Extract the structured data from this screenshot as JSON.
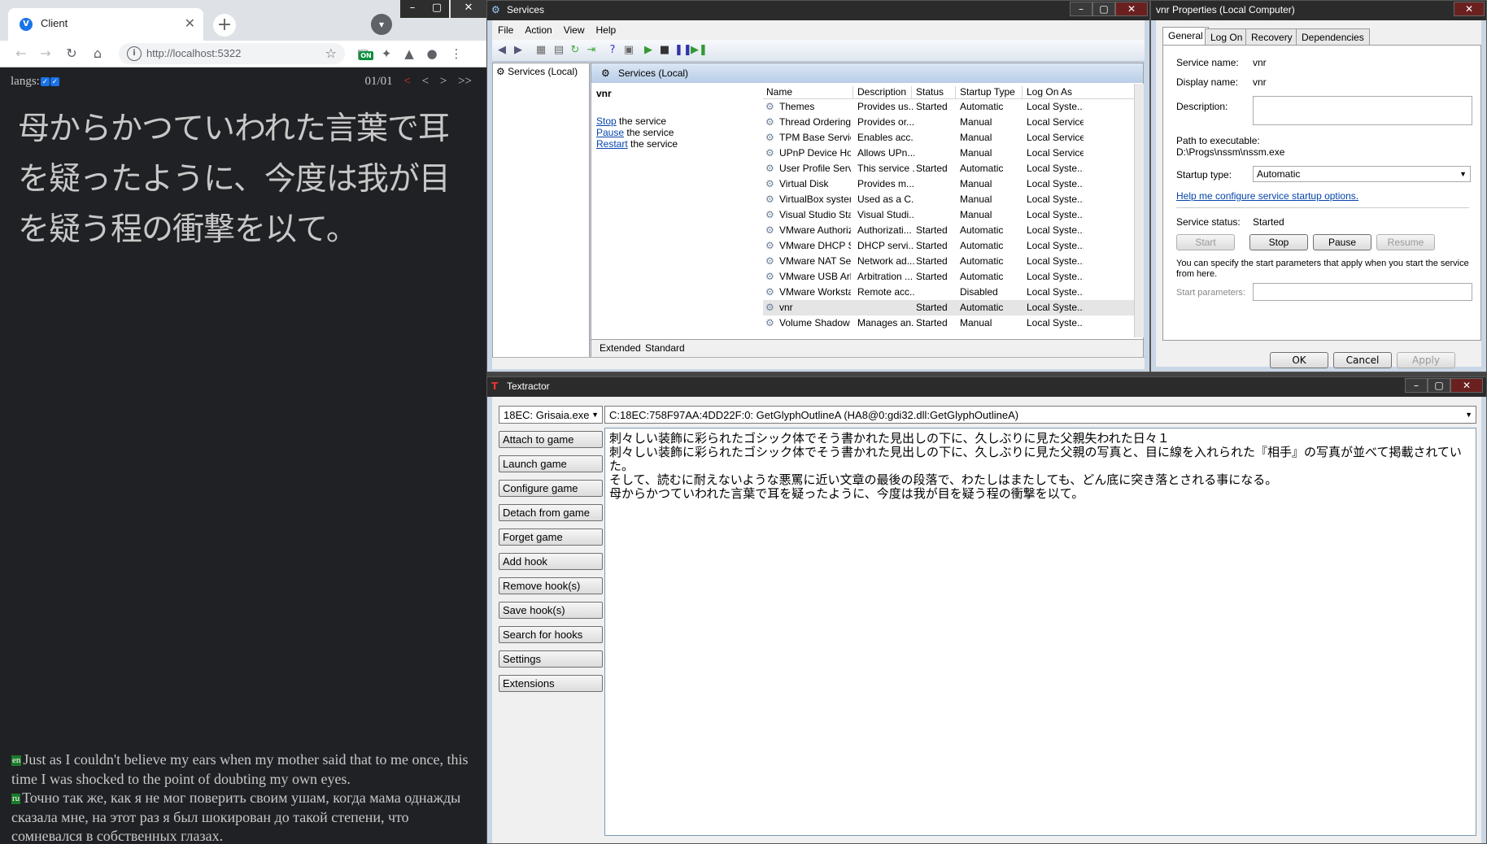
{
  "chrome": {
    "tab_title": "Client",
    "favicon_letter": "V",
    "url": "http://localhost:5322",
    "on_badge": "ON",
    "page": {
      "langs_label": "langs:",
      "pager": {
        "count": "01/01",
        "first": "<",
        "prev": "<",
        "next": ">",
        "last": ">>"
      },
      "japanese_text": "母からかつていわれた言葉で耳を疑ったように、今度は我が目を疑う程の衝撃を以て。",
      "translations": [
        {
          "lang": "en",
          "text": "Just as I couldn't believe my ears when my mother said that to me once, this time I was shocked to the point of doubting my own eyes."
        },
        {
          "lang": "ru",
          "text": "Точно так же, как я не мог поверить своим ушам, когда мама однажды сказала мне, на этот раз я был шокирован до такой степени, что сомневался в собственных глазах."
        }
      ]
    }
  },
  "services": {
    "title": "Services",
    "menu": [
      "File",
      "Action",
      "View",
      "Help"
    ],
    "tree_node": "Services (Local)",
    "header": "Services (Local)",
    "selected_name": "vnr",
    "actions": [
      {
        "link": "Stop",
        "rest": " the service"
      },
      {
        "link": "Pause",
        "rest": " the service"
      },
      {
        "link": "Restart",
        "rest": " the service"
      }
    ],
    "columns": [
      "Name",
      "Description",
      "Status",
      "Startup Type",
      "Log On As"
    ],
    "rows": [
      [
        "Themes",
        "Provides us...",
        "Started",
        "Automatic",
        "Local Syste..."
      ],
      [
        "Thread Ordering S...",
        "Provides or...",
        "",
        "Manual",
        "Local Service"
      ],
      [
        "TPM Base Services",
        "Enables acc...",
        "",
        "Manual",
        "Local Service"
      ],
      [
        "UPnP Device Host",
        "Allows UPn...",
        "",
        "Manual",
        "Local Service"
      ],
      [
        "User Profile Service",
        "This service ...",
        "Started",
        "Automatic",
        "Local Syste..."
      ],
      [
        "Virtual Disk",
        "Provides m...",
        "",
        "Manual",
        "Local Syste..."
      ],
      [
        "VirtualBox system ...",
        "Used as a C...",
        "",
        "Manual",
        "Local Syste..."
      ],
      [
        "Visual Studio Stan...",
        "Visual Studi...",
        "",
        "Manual",
        "Local Syste..."
      ],
      [
        "VMware Authoriza...",
        "Authorizati...",
        "Started",
        "Automatic",
        "Local Syste..."
      ],
      [
        "VMware DHCP Ser...",
        "DHCP servi...",
        "Started",
        "Automatic",
        "Local Syste..."
      ],
      [
        "VMware NAT Serv...",
        "Network ad...",
        "Started",
        "Automatic",
        "Local Syste..."
      ],
      [
        "VMware USB Arbit...",
        "Arbitration ...",
        "Started",
        "Automatic",
        "Local Syste..."
      ],
      [
        "VMware Workstati...",
        "Remote acc...",
        "",
        "Disabled",
        "Local Syste..."
      ],
      [
        "vnr",
        "",
        "Started",
        "Automatic",
        "Local Syste..."
      ],
      [
        "Volume Shadow C...",
        "Manages an...",
        "Started",
        "Manual",
        "Local Syste..."
      ]
    ],
    "tabs": [
      "Extended",
      "Standard"
    ]
  },
  "props": {
    "title": "vnr Properties (Local Computer)",
    "tabs": [
      "General",
      "Log On",
      "Recovery",
      "Dependencies"
    ],
    "service_name_label": "Service name:",
    "service_name": "vnr",
    "display_name_label": "Display name:",
    "display_name": "vnr",
    "description_label": "Description:",
    "path_label": "Path to executable:",
    "path": "D:\\Progs\\nssm\\nssm.exe",
    "startup_type_label": "Startup type:",
    "startup_type": "Automatic",
    "help_link": "Help me configure service startup options.",
    "status_label": "Service status:",
    "status": "Started",
    "buttons": {
      "start": "Start",
      "stop": "Stop",
      "pause": "Pause",
      "resume": "Resume"
    },
    "note": "You can specify the start parameters that apply when you start the service from here.",
    "start_params_label": "Start parameters:",
    "ok": "OK",
    "cancel": "Cancel",
    "apply": "Apply"
  },
  "textractor": {
    "title": "Textractor",
    "process": "18EC: Grisaia.exe",
    "hook": "C:18EC:758F97AA:4DD22F:0: GetGlyphOutlineA (HA8@0:gdi32.dll:GetGlyphOutlineA)",
    "buttons": [
      "Attach to game",
      "Launch game",
      "Configure game",
      "Detach from game",
      "Forget game",
      "Add hook",
      "Remove hook(s)",
      "Save hook(s)",
      "Search for hooks",
      "Settings",
      "Extensions"
    ],
    "text": "刺々しい装飾に彩られたゴシック体でそう書かれた見出しの下に、久しぶりに見た父親失われた日々１\n刺々しい装飾に彩られたゴシック体でそう書かれた見出しの下に、久しぶりに見た父親の写真と、目に線を入れられた『相手』の写真が並べて掲載されていた。\nそして、読むに耐えないような悪罵に近い文章の最後の段落で、わたしはまたしても、どん底に突き落とされる事になる。\n母からかつていわれた言葉で耳を疑ったように、今度は我が目を疑う程の衝撃を以て。"
  }
}
